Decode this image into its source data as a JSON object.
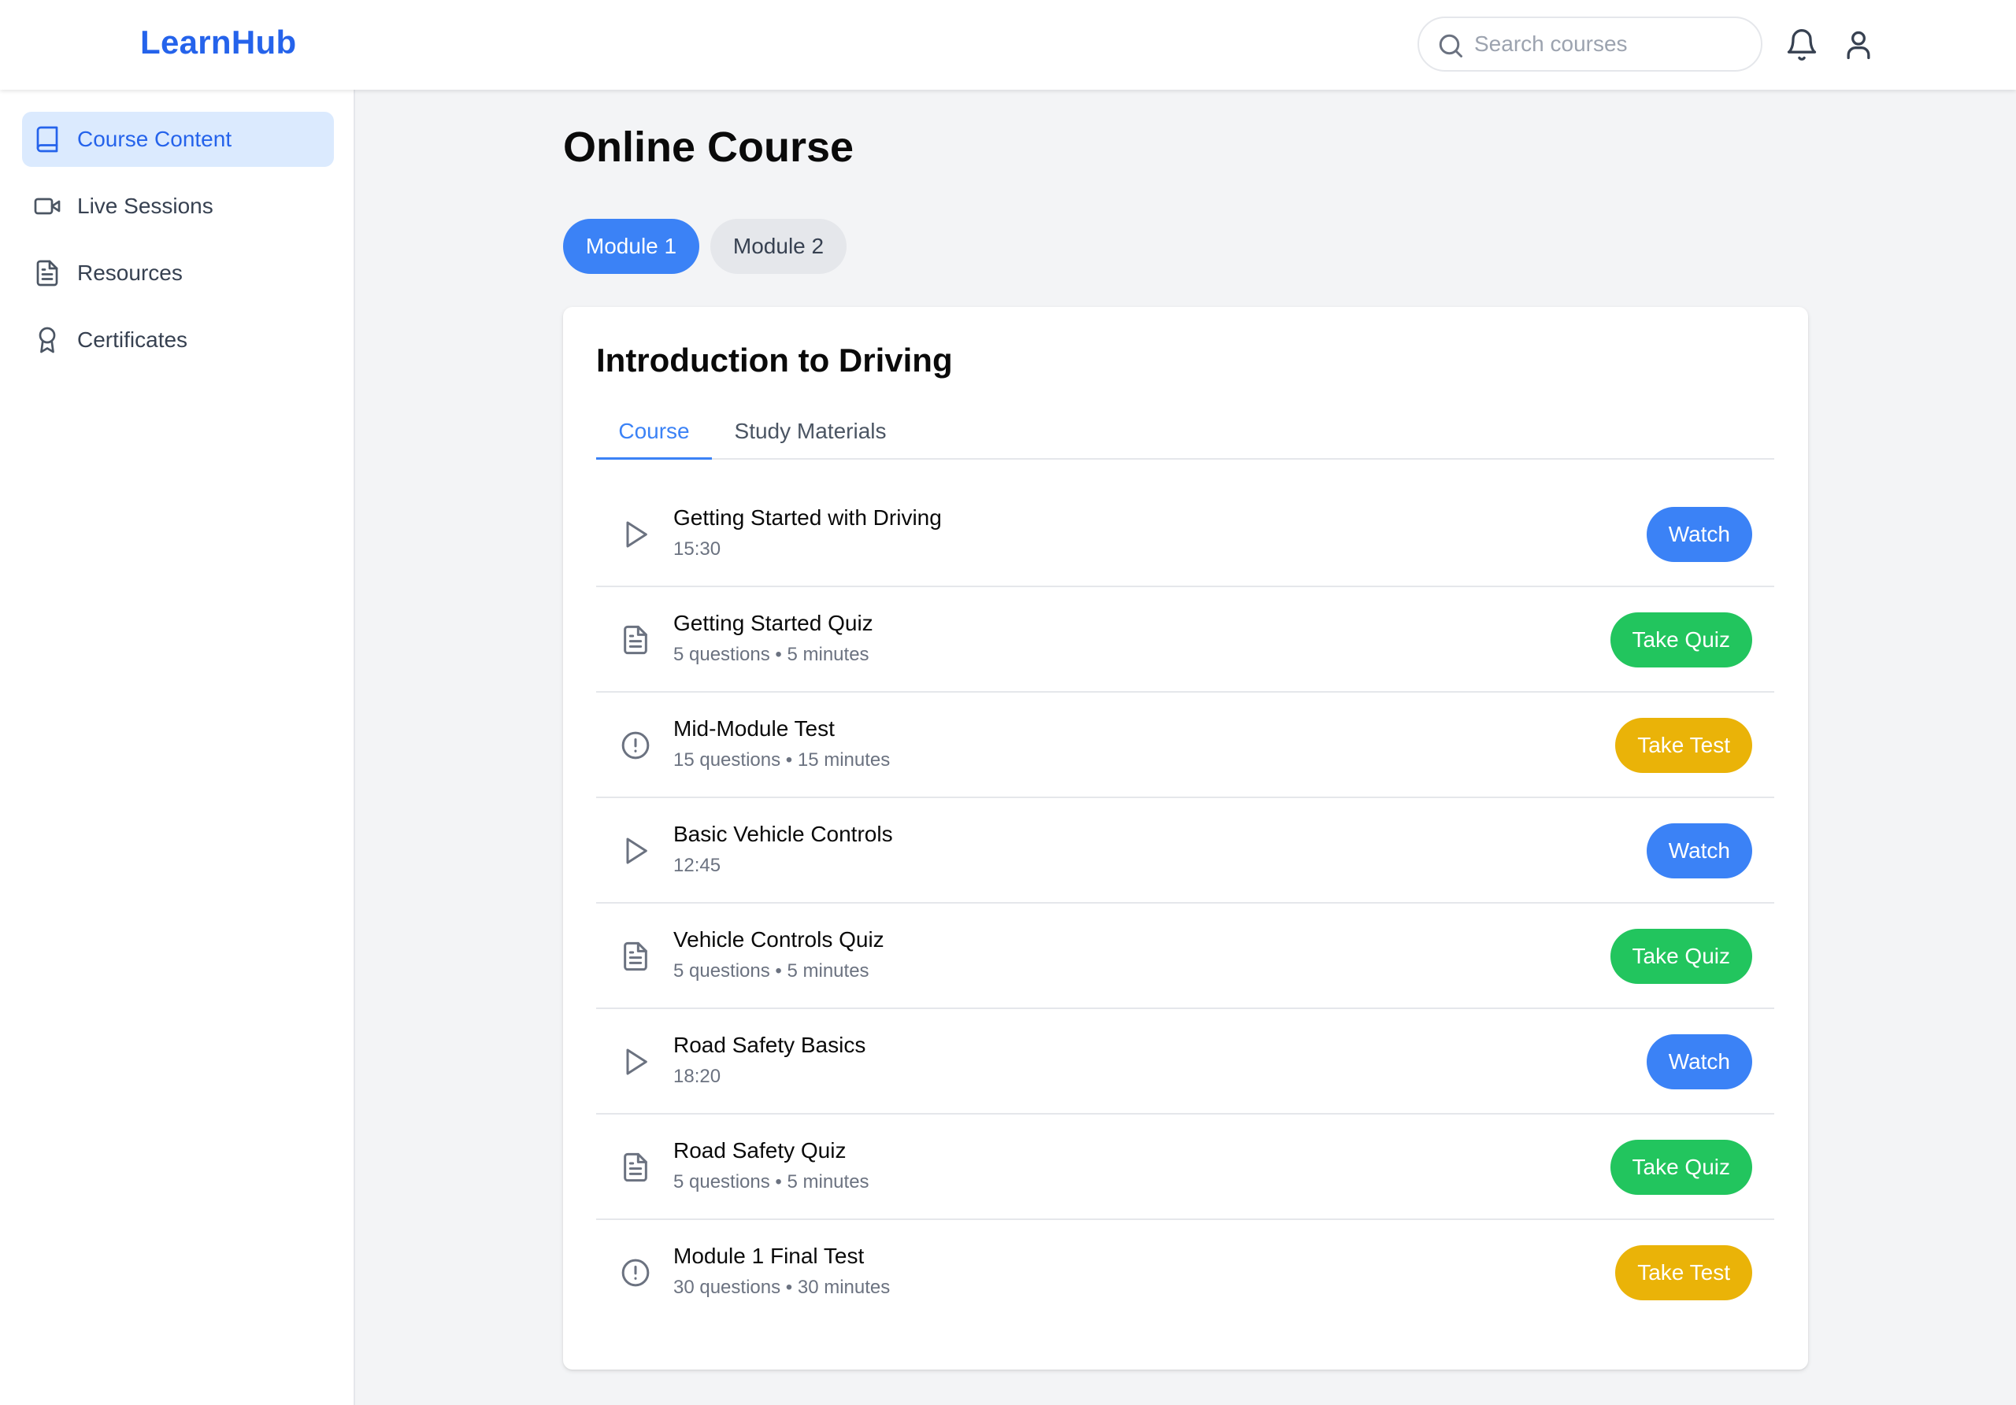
{
  "app": {
    "brand": "LearnHub"
  },
  "header": {
    "search_placeholder": "Search courses",
    "icons": [
      "search-icon",
      "bell-icon",
      "user-icon"
    ]
  },
  "sidebar": {
    "items": [
      {
        "label": "Course Content",
        "icon": "book-icon",
        "active": true
      },
      {
        "label": "Live Sessions",
        "icon": "video-icon",
        "active": false
      },
      {
        "label": "Resources",
        "icon": "file-text-icon",
        "active": false
      },
      {
        "label": "Certificates",
        "icon": "award-icon",
        "active": false
      }
    ]
  },
  "main": {
    "title": "Online Course",
    "modules": [
      {
        "label": "Module 1",
        "active": true
      },
      {
        "label": "Module 2",
        "active": false
      }
    ],
    "card": {
      "title": "Introduction to Driving",
      "tabs": [
        {
          "label": "Course",
          "active": true
        },
        {
          "label": "Study Materials",
          "active": false
        }
      ],
      "items": [
        {
          "title": "Getting Started with Driving",
          "meta": "15:30",
          "icon": "play-icon",
          "action": "Watch"
        },
        {
          "title": "Getting Started Quiz",
          "meta": "5 questions • 5 minutes",
          "icon": "document-icon",
          "action": "Take Quiz"
        },
        {
          "title": "Mid-Module Test",
          "meta": "15 questions • 15 minutes",
          "icon": "alert-circle-icon",
          "action": "Take Test"
        },
        {
          "title": "Basic Vehicle Controls",
          "meta": "12:45",
          "icon": "play-icon",
          "action": "Watch"
        },
        {
          "title": "Vehicle Controls Quiz",
          "meta": "5 questions • 5 minutes",
          "icon": "document-icon",
          "action": "Take Quiz"
        },
        {
          "title": "Road Safety Basics",
          "meta": "18:20",
          "icon": "play-icon",
          "action": "Watch"
        },
        {
          "title": "Road Safety Quiz",
          "meta": "5 questions • 5 minutes",
          "icon": "document-icon",
          "action": "Take Quiz"
        },
        {
          "title": "Module 1 Final Test",
          "meta": "30 questions • 30 minutes",
          "icon": "alert-circle-icon",
          "action": "Take Test"
        }
      ]
    }
  },
  "colors": {
    "brand": "#2563eb",
    "primary": "#3b82f6",
    "quiz": "#22c55e",
    "test": "#eab308",
    "active_nav_bg": "#dbeafe",
    "page_bg": "#f3f4f6"
  }
}
